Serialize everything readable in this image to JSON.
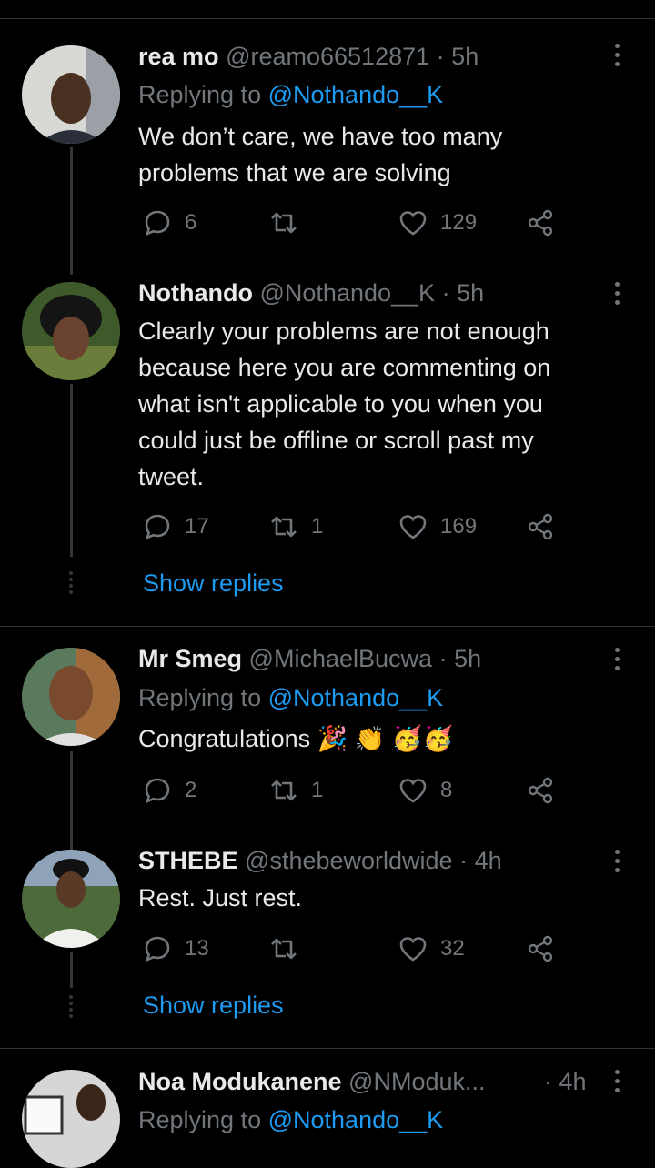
{
  "tweets": [
    {
      "name": "rea mo",
      "handle": "@reamo66512871",
      "time": "5h",
      "replying_prefix": "Replying to",
      "replying_to": "@Nothando__K",
      "text": "We don’t care, we have too many problems that we are solving",
      "replies": "6",
      "retweets": "",
      "likes": "129"
    },
    {
      "name": "Nothando",
      "handle": "@Nothando__K",
      "time": "5h",
      "text": "Clearly your problems are not enough because here you are commenting on what isn't applicable to you when you could just be offline or scroll past my tweet.",
      "replies": "17",
      "retweets": "1",
      "likes": "169",
      "show_replies": "Show replies"
    },
    {
      "name": "Mr Smeg",
      "handle": "@MichaelBucwa",
      "time": "5h",
      "replying_prefix": "Replying to",
      "replying_to": "@Nothando__K",
      "text": "Congratulations 🎉 👏 🥳🥳",
      "replies": "2",
      "retweets": "1",
      "likes": "8"
    },
    {
      "name": "STHEBE",
      "handle": "@sthebeworldwide",
      "time": "4h",
      "text": "Rest. Just rest.",
      "replies": "13",
      "retweets": "",
      "likes": "32",
      "show_replies": "Show replies"
    },
    {
      "name": "Noa Modukanene",
      "handle": "@NModuk...",
      "time": "4h",
      "replying_prefix": "Replying to",
      "replying_to": "@Nothando__K"
    }
  ],
  "separator": "·",
  "icons": {
    "reply": "reply-icon",
    "retweet": "retweet-icon",
    "like": "heart-icon",
    "share": "share-icon",
    "more": "more-icon"
  },
  "colors": {
    "background": "#000000",
    "link": "#1d9bf0",
    "muted": "#71767b",
    "text": "#e7e9ea"
  }
}
